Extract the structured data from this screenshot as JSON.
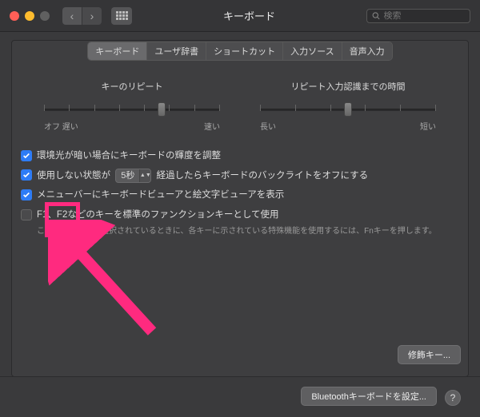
{
  "window": {
    "title": "キーボード",
    "search_placeholder": "検索"
  },
  "tabs": [
    {
      "label": "キーボード",
      "active": true
    },
    {
      "label": "ユーザ辞書",
      "active": false
    },
    {
      "label": "ショートカット",
      "active": false
    },
    {
      "label": "入力ソース",
      "active": false
    },
    {
      "label": "音声入力",
      "active": false
    }
  ],
  "sliders": {
    "repeat": {
      "title": "キーのリピート",
      "left_label": "オフ 遅い",
      "right_label": "速い",
      "ticks": 8,
      "pos_pct": 67
    },
    "delay": {
      "title": "リピート入力認識までの時間",
      "left_label": "長い",
      "right_label": "短い",
      "ticks": 6,
      "pos_pct": 50
    }
  },
  "options": {
    "adjust_brightness": {
      "checked": true,
      "label": "環境光が暗い場合にキーボードの輝度を調整"
    },
    "backlight_off": {
      "checked": true,
      "prefix": "使用しない状態が",
      "select": "5秒",
      "suffix": "経過したらキーボードのバックライトをオフにする"
    },
    "show_viewers": {
      "checked": true,
      "label": "メニューバーにキーボードビューアと絵文字ビューアを表示"
    },
    "fn_keys": {
      "checked": false,
      "label": "F1、F2などのキーを標準のファンクションキーとして使用",
      "hint": "このオプションが選択されているときに、各キーに示されている特殊機能を使用するには、Fnキーを押します。"
    }
  },
  "buttons": {
    "modifier": "修飾キー...",
    "bluetooth": "Bluetoothキーボードを設定..."
  }
}
